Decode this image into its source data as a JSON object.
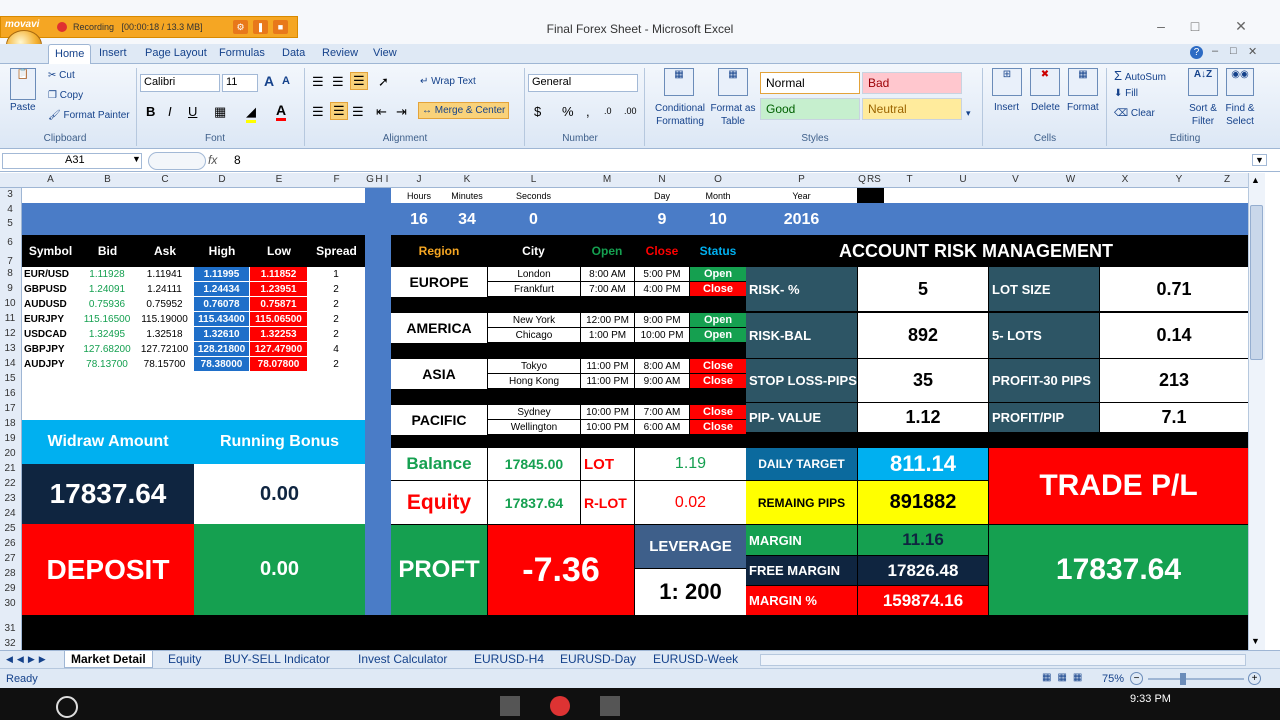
{
  "window": {
    "title": "Final Forex Sheet - Microsoft Excel"
  },
  "recorder": {
    "brand": "movavi",
    "status": "Recording",
    "time": "[00:00:18 / 13.3 MB]"
  },
  "tabs": [
    "Home",
    "Insert",
    "Page Layout",
    "Formulas",
    "Data",
    "Review",
    "View"
  ],
  "ribbon": {
    "clipboard": {
      "label": "Clipboard",
      "paste": "Paste",
      "cut": "Cut",
      "copy": "Copy",
      "format_painter": "Format Painter"
    },
    "font": {
      "label": "Font",
      "name": "Calibri",
      "size": "11"
    },
    "alignment": {
      "label": "Alignment",
      "wrap": "Wrap Text",
      "merge": "Merge & Center"
    },
    "number": {
      "label": "Number",
      "format": "General"
    },
    "styles": {
      "label": "Styles",
      "conditional": "Conditional Formatting",
      "format_table": "Format as Table",
      "normal": "Normal",
      "bad": "Bad",
      "good": "Good",
      "neutral": "Neutral"
    },
    "cells": {
      "label": "Cells",
      "insert": "Insert",
      "delete": "Delete",
      "format": "Format"
    },
    "editing": {
      "label": "Editing",
      "autosum": "AutoSum",
      "fill": "Fill",
      "clear": "Clear",
      "sort": "Sort & Filter",
      "find": "Find & Select"
    }
  },
  "formula": {
    "cell": "A31",
    "value": "8"
  },
  "columns": [
    "A",
    "B",
    "C",
    "D",
    "E",
    "F",
    "G",
    "H",
    "I",
    "J",
    "K",
    "L",
    "M",
    "N",
    "O",
    "P",
    "Q",
    "R",
    "S",
    "T",
    "U",
    "V",
    "W",
    "X",
    "Y",
    "Z"
  ],
  "rows": [
    "3",
    "4",
    "5",
    "6",
    "7",
    "8",
    "9",
    "10",
    "11",
    "12",
    "13",
    "14",
    "15",
    "16",
    "17",
    "18",
    "19",
    "20",
    "21",
    "22",
    "23",
    "24",
    "25",
    "26",
    "27",
    "28",
    "29",
    "30",
    "31",
    "32"
  ],
  "time": {
    "headers": [
      "Hours",
      "Minutes",
      "Seconds",
      "Day",
      "Month",
      "Year"
    ],
    "values": [
      "16",
      "34",
      "0",
      "9",
      "10",
      "2016"
    ]
  },
  "market": {
    "headers": [
      "Symbol",
      "Bid",
      "Ask",
      "High",
      "Low",
      "Spread"
    ],
    "rows": [
      [
        "EUR/USD",
        "1.11928",
        "1.11941",
        "1.11995",
        "1.11852",
        "1"
      ],
      [
        "GBPUSD",
        "1.24091",
        "1.24111",
        "1.24434",
        "1.23951",
        "2"
      ],
      [
        "AUDUSD",
        "0.75936",
        "0.75952",
        "0.76078",
        "0.75871",
        "2"
      ],
      [
        "EURJPY",
        "115.16500",
        "115.19000",
        "115.43400",
        "115.06500",
        "2"
      ],
      [
        "USDCAD",
        "1.32495",
        "1.32518",
        "1.32610",
        "1.32253",
        "2"
      ],
      [
        "GBPJPY",
        "127.68200",
        "127.72100",
        "128.21800",
        "127.47900",
        "4"
      ],
      [
        "AUDJPY",
        "78.13700",
        "78.15700",
        "78.38000",
        "78.07800",
        "2"
      ]
    ]
  },
  "sessions": {
    "headers": [
      "Region",
      "City",
      "Open",
      "Close",
      "Status"
    ],
    "regions": [
      {
        "name": "EUROPE",
        "cities": [
          [
            "London",
            "8:00 AM",
            "5:00 PM",
            "Open"
          ],
          [
            "Frankfurt",
            "7:00 AM",
            "4:00 PM",
            "Close"
          ]
        ]
      },
      {
        "name": "AMERICA",
        "cities": [
          [
            "New York",
            "12:00 PM",
            "9:00 PM",
            "Open"
          ],
          [
            "Chicago",
            "1:00 PM",
            "10:00 PM",
            "Open"
          ]
        ]
      },
      {
        "name": "ASIA",
        "cities": [
          [
            "Tokyo",
            "11:00 PM",
            "8:00 AM",
            "Close"
          ],
          [
            "Hong Kong",
            "11:00 PM",
            "9:00 AM",
            "Close"
          ]
        ]
      },
      {
        "name": "PACIFIC",
        "cities": [
          [
            "Sydney",
            "10:00 PM",
            "7:00 AM",
            "Close"
          ],
          [
            "Wellington",
            "10:00 PM",
            "6:00 AM",
            "Close"
          ]
        ]
      }
    ]
  },
  "risk": {
    "title": "ACCOUNT RISK MANAGEMENT",
    "rows": [
      [
        "RISK- %",
        "5",
        "LOT SIZE",
        "0.71"
      ],
      [
        "RISK-BAL",
        "892",
        "5- LOTS",
        "0.14"
      ],
      [
        "STOP LOSS-PIPS",
        "35",
        "PROFIT-30 PIPS",
        "213"
      ],
      [
        "PIP- VALUE",
        "1.12",
        "PROFIT/PIP",
        "7.1"
      ]
    ]
  },
  "account": {
    "withdraw_label": "Widraw Amount",
    "bonus_label": "Running Bonus",
    "withdraw_value": "17837.64",
    "bonus_value": "0.00",
    "deposit_label": "DEPOSIT",
    "deposit_value": "0.00",
    "balance_label": "Balance",
    "balance_value": "17845.00",
    "lot_label": "LOT",
    "lot_value": "1.19",
    "equity_label": "Equity",
    "equity_value": "17837.64",
    "rlot_label": "R-LOT",
    "rlot_value": "0.02",
    "profit_label": "PROFT",
    "profit_value": "-7.36",
    "leverage_label": "LEVERAGE",
    "leverage_value": "1: 200",
    "daily_target_label": "DAILY TARGET",
    "daily_target_value": "811.14",
    "remain_label": "REMAING PIPS",
    "remain_value": "891882",
    "margin_label": "MARGIN",
    "margin_value": "11.16",
    "free_margin_label": "FREE MARGIN",
    "free_margin_value": "17826.48",
    "margin_pct_label": "MARGIN %",
    "margin_pct_value": "159874.16",
    "trade_label": "TRADE P/L",
    "trade_value": "17837.64"
  },
  "sheets": [
    "Market Detail",
    "Equity",
    "BUY-SELL Indicator",
    "Invest Calculator",
    "EURUSD-H4",
    "EURUSD-Day",
    "EURUSD-Week"
  ],
  "status": {
    "ready": "Ready",
    "zoom": "75%",
    "clock": "9:33 PM"
  },
  "colors": {
    "accent_blue": "#4a7cc7",
    "teal": "#2d5565",
    "green": "#15a050",
    "red": "#ff0000",
    "sky": "#00b0f0",
    "navy": "#0f2540"
  }
}
